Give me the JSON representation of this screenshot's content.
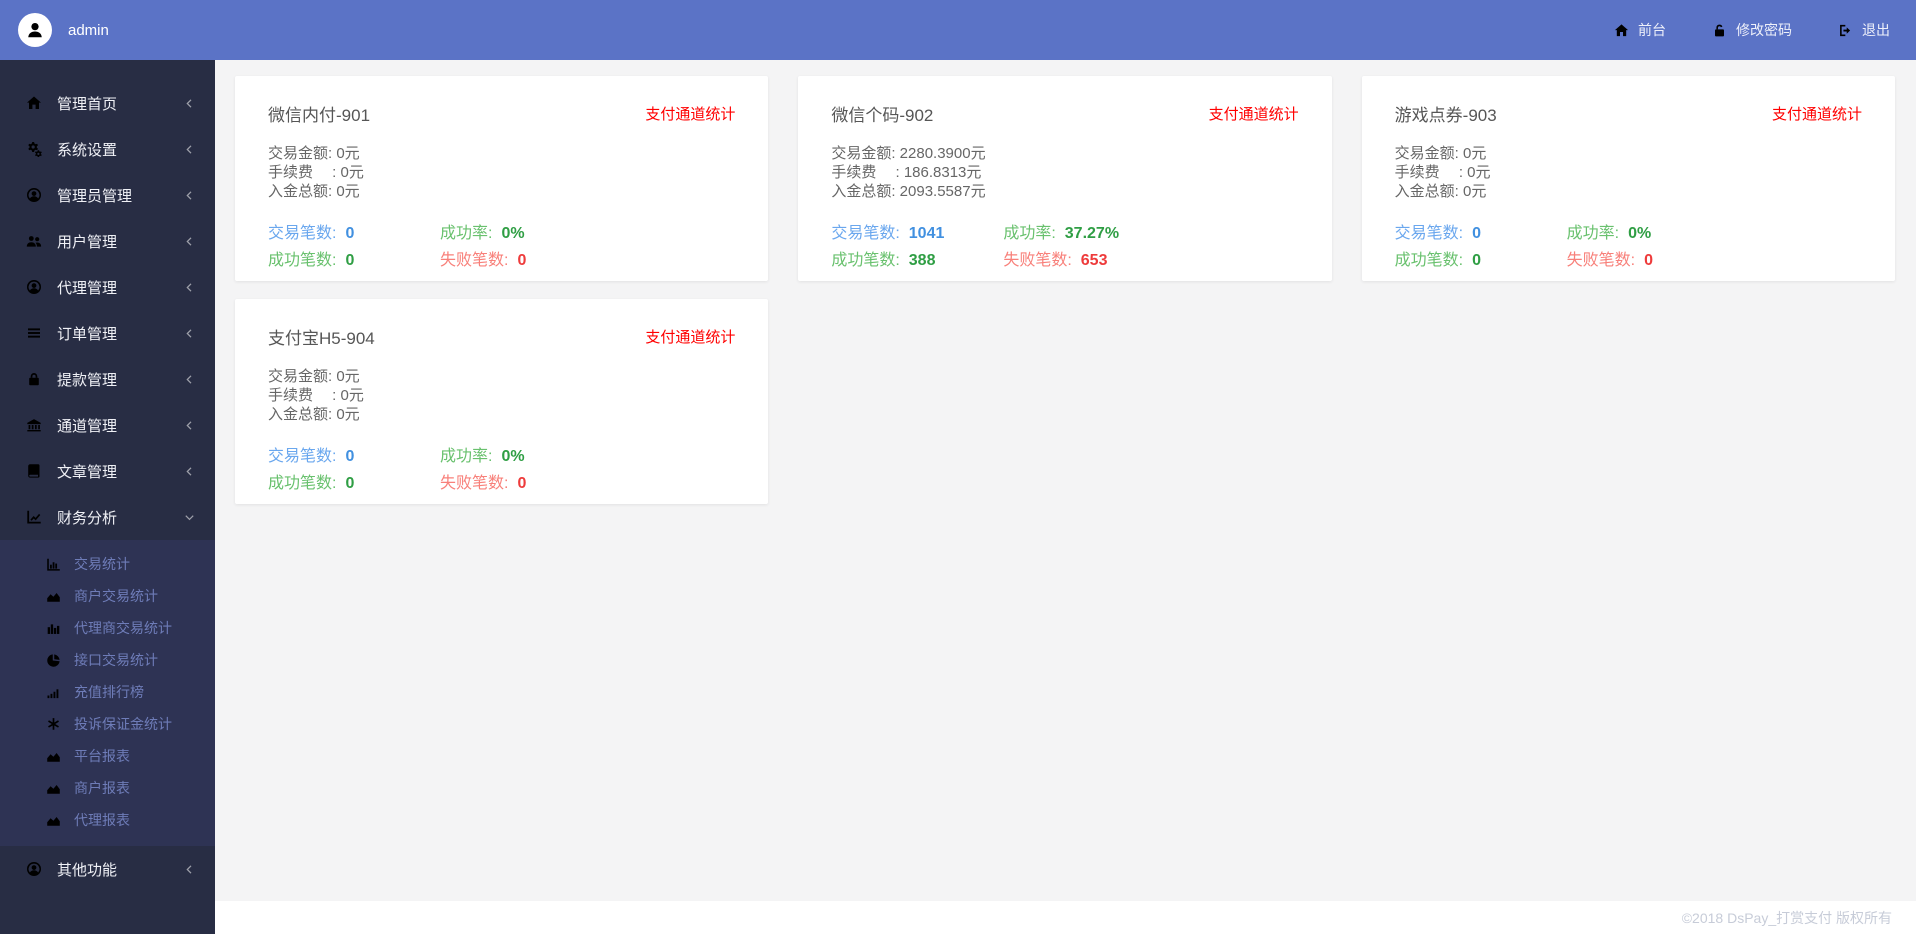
{
  "header": {
    "user": "admin",
    "nav": [
      {
        "label": "前台",
        "icon": "home"
      },
      {
        "label": "修改密码",
        "icon": "unlock"
      },
      {
        "label": "退出",
        "icon": "sign-out"
      }
    ]
  },
  "sidebar": {
    "items": [
      {
        "label": "管理首页",
        "icon": "home"
      },
      {
        "label": "系统设置",
        "icon": "gears"
      },
      {
        "label": "管理员管理",
        "icon": "user-circle"
      },
      {
        "label": "用户管理",
        "icon": "users"
      },
      {
        "label": "代理管理",
        "icon": "user-circle"
      },
      {
        "label": "订单管理",
        "icon": "list"
      },
      {
        "label": "提款管理",
        "icon": "lock"
      },
      {
        "label": "通道管理",
        "icon": "bank"
      },
      {
        "label": "文章管理",
        "icon": "book"
      },
      {
        "label": "财务分析",
        "icon": "line-chart",
        "expanded": true
      },
      {
        "label": "其他功能",
        "icon": "user-circle"
      }
    ],
    "submenu": [
      {
        "label": "交易统计",
        "icon": "bar-chart"
      },
      {
        "label": "商户交易统计",
        "icon": "area-chart"
      },
      {
        "label": "代理商交易统计",
        "icon": "bars-solid"
      },
      {
        "label": "接口交易统计",
        "icon": "pie-chart"
      },
      {
        "label": "充值排行榜",
        "icon": "signal"
      },
      {
        "label": "投诉保证金统计",
        "icon": "asterisk"
      },
      {
        "label": "平台报表",
        "icon": "area-chart"
      },
      {
        "label": "商户报表",
        "icon": "area-chart"
      },
      {
        "label": "代理报表",
        "icon": "area-chart"
      }
    ]
  },
  "cards": [
    {
      "title": "微信内付-901",
      "link": "支付通道统计",
      "amounts": [
        "交易金额: 0元",
        "手续费　 : 0元",
        "入金总额: 0元"
      ],
      "stats": {
        "trade_label": "交易笔数:",
        "trade_value": "0",
        "rate_label": "成功率:",
        "rate_value": "0%",
        "success_label": "成功笔数:",
        "success_value": "0",
        "fail_label": "失败笔数:",
        "fail_value": "0"
      }
    },
    {
      "title": "微信个码-902",
      "link": "支付通道统计",
      "amounts": [
        "交易金额: 2280.3900元",
        "手续费　 : 186.8313元",
        "入金总额: 2093.5587元"
      ],
      "stats": {
        "trade_label": "交易笔数:",
        "trade_value": "1041",
        "rate_label": "成功率:",
        "rate_value": "37.27%",
        "success_label": "成功笔数:",
        "success_value": "388",
        "fail_label": "失败笔数:",
        "fail_value": "653"
      }
    },
    {
      "title": "游戏点券-903",
      "link": "支付通道统计",
      "amounts": [
        "交易金额: 0元",
        "手续费　 : 0元",
        "入金总额: 0元"
      ],
      "stats": {
        "trade_label": "交易笔数:",
        "trade_value": "0",
        "rate_label": "成功率:",
        "rate_value": "0%",
        "success_label": "成功笔数:",
        "success_value": "0",
        "fail_label": "失败笔数:",
        "fail_value": "0"
      }
    },
    {
      "title": "支付宝H5-904",
      "link": "支付通道统计",
      "amounts": [
        "交易金额: 0元",
        "手续费　 : 0元",
        "入金总额: 0元"
      ],
      "stats": {
        "trade_label": "交易笔数:",
        "trade_value": "0",
        "rate_label": "成功率:",
        "rate_value": "0%",
        "success_label": "成功笔数:",
        "success_value": "0",
        "fail_label": "失败笔数:",
        "fail_value": "0"
      }
    }
  ],
  "footer": {
    "copyright": "©2018 DsPay_打赏支付 版权所有"
  },
  "colors": {
    "header_bg": "#5b73c6",
    "sidebar_bg": "#282d44",
    "submenu_bg": "#2e3354",
    "main_bg": "#f4f4f5",
    "link_red": "#ff0000",
    "stat_blue": "#4190e0",
    "stat_green": "#2f9e44",
    "stat_red": "#ee3b3b"
  }
}
